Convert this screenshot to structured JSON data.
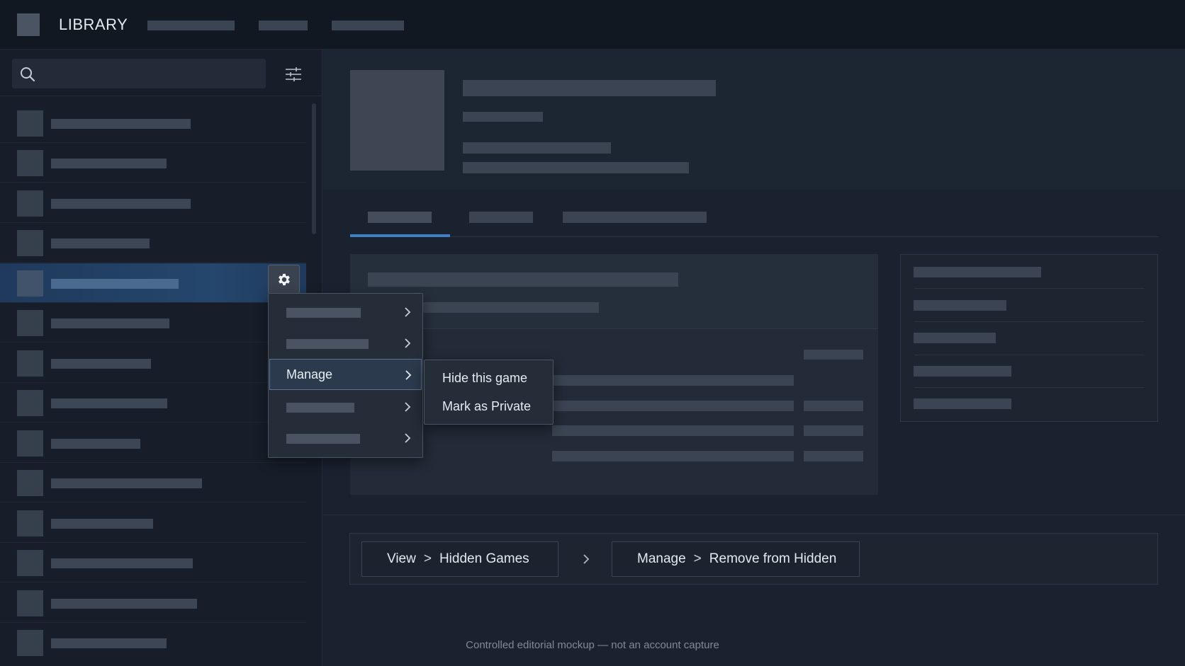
{
  "topbar": {
    "brand": "LIBRARY"
  },
  "search": {
    "placeholder": ""
  },
  "context_menu": {
    "active_label": "Manage"
  },
  "submenu": {
    "items": [
      "Hide this game",
      "Mark as Private"
    ]
  },
  "breadcrumbs": {
    "first": {
      "part1": "View",
      "sep": ">",
      "part2": "Hidden Games"
    },
    "second": {
      "part1": "Manage",
      "sep": ">",
      "part2": "Remove from Hidden"
    }
  },
  "footer": {
    "disclaimer": "Controlled editorial mockup — not an account capture"
  },
  "colors": {
    "accent": "#3f7fc4",
    "selected_row": "#25466d",
    "background": "#1a2230"
  },
  "icons": [
    "search-icon",
    "filter-icon",
    "gear-icon",
    "chevron-right-icon"
  ]
}
